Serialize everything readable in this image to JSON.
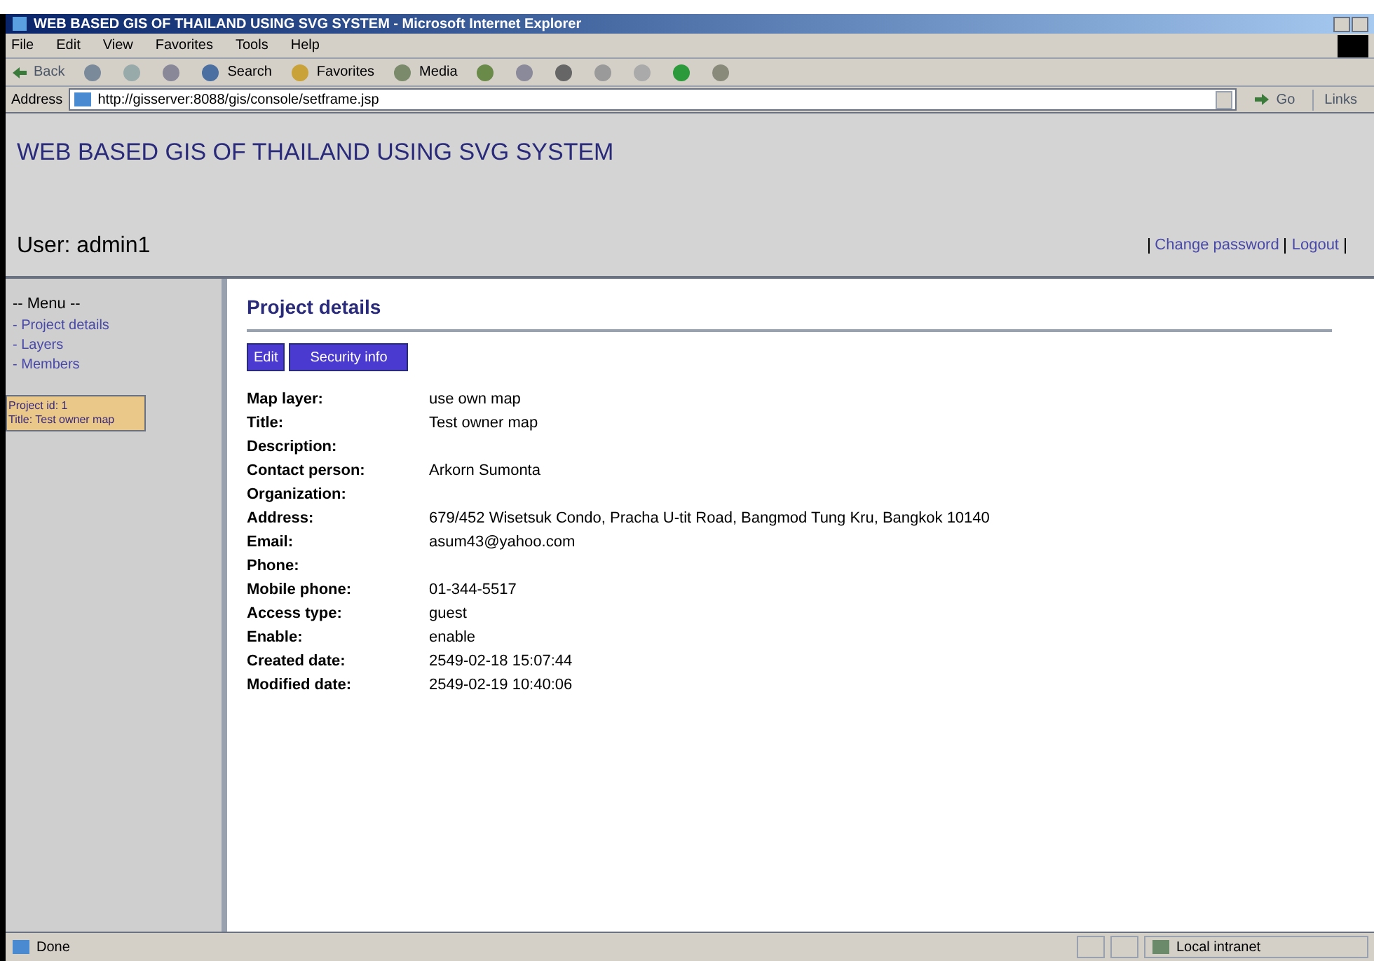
{
  "window": {
    "title": "WEB BASED GIS OF THAILAND USING SVG SYSTEM - Microsoft Internet Explorer"
  },
  "menu_bar": [
    "File",
    "Edit",
    "View",
    "Favorites",
    "Tools",
    "Help"
  ],
  "toolbar": {
    "back": "Back",
    "search": "Search",
    "favorites": "Favorites",
    "media": "Media"
  },
  "address_bar": {
    "label": "Address",
    "url": "http://gisserver:8088/gis/console/setframe.jsp",
    "go": "Go",
    "links": "Links"
  },
  "header": {
    "title": "WEB BASED GIS OF THAILAND USING SVG SYSTEM",
    "user": "User: admin1",
    "links": [
      "Change password",
      "Logout"
    ]
  },
  "sidebar": {
    "heading": "-- Menu --",
    "items": [
      "- Project details",
      "- Layers",
      "- Members"
    ],
    "info": [
      "Project id: 1",
      "Title: Test owner map"
    ]
  },
  "content": {
    "heading": "Project details",
    "buttons": [
      "Edit",
      "Security info"
    ],
    "fields": [
      {
        "label": "Map layer:",
        "value": "use own map"
      },
      {
        "label": "Title:",
        "value": "Test owner map"
      },
      {
        "label": "Description:"
      },
      {
        "label": "Contact person:",
        "value": "Arkorn Sumonta"
      },
      {
        "label": "Organization:"
      },
      {
        "label": "Address:",
        "value": "679/452 Wisetsuk Condo, Pracha U-tit Road, Bangmod Tung Kru, Bangkok 10140"
      },
      {
        "label": "Email:",
        "value": "asum43@yahoo.com"
      },
      {
        "label": "Phone:"
      },
      {
        "label": "Mobile phone:",
        "value": "01-344-5517"
      },
      {
        "label": "Access type:",
        "value": "guest"
      },
      {
        "label": "Enable:",
        "value": "enable"
      },
      {
        "label": "Created date:",
        "value": "2549-02-18 15:07:44"
      },
      {
        "label": "Modified date:",
        "value": "2549-02-19 10:40:06"
      }
    ]
  },
  "status_bar": {
    "text": "Done",
    "zone": "Local intranet"
  }
}
